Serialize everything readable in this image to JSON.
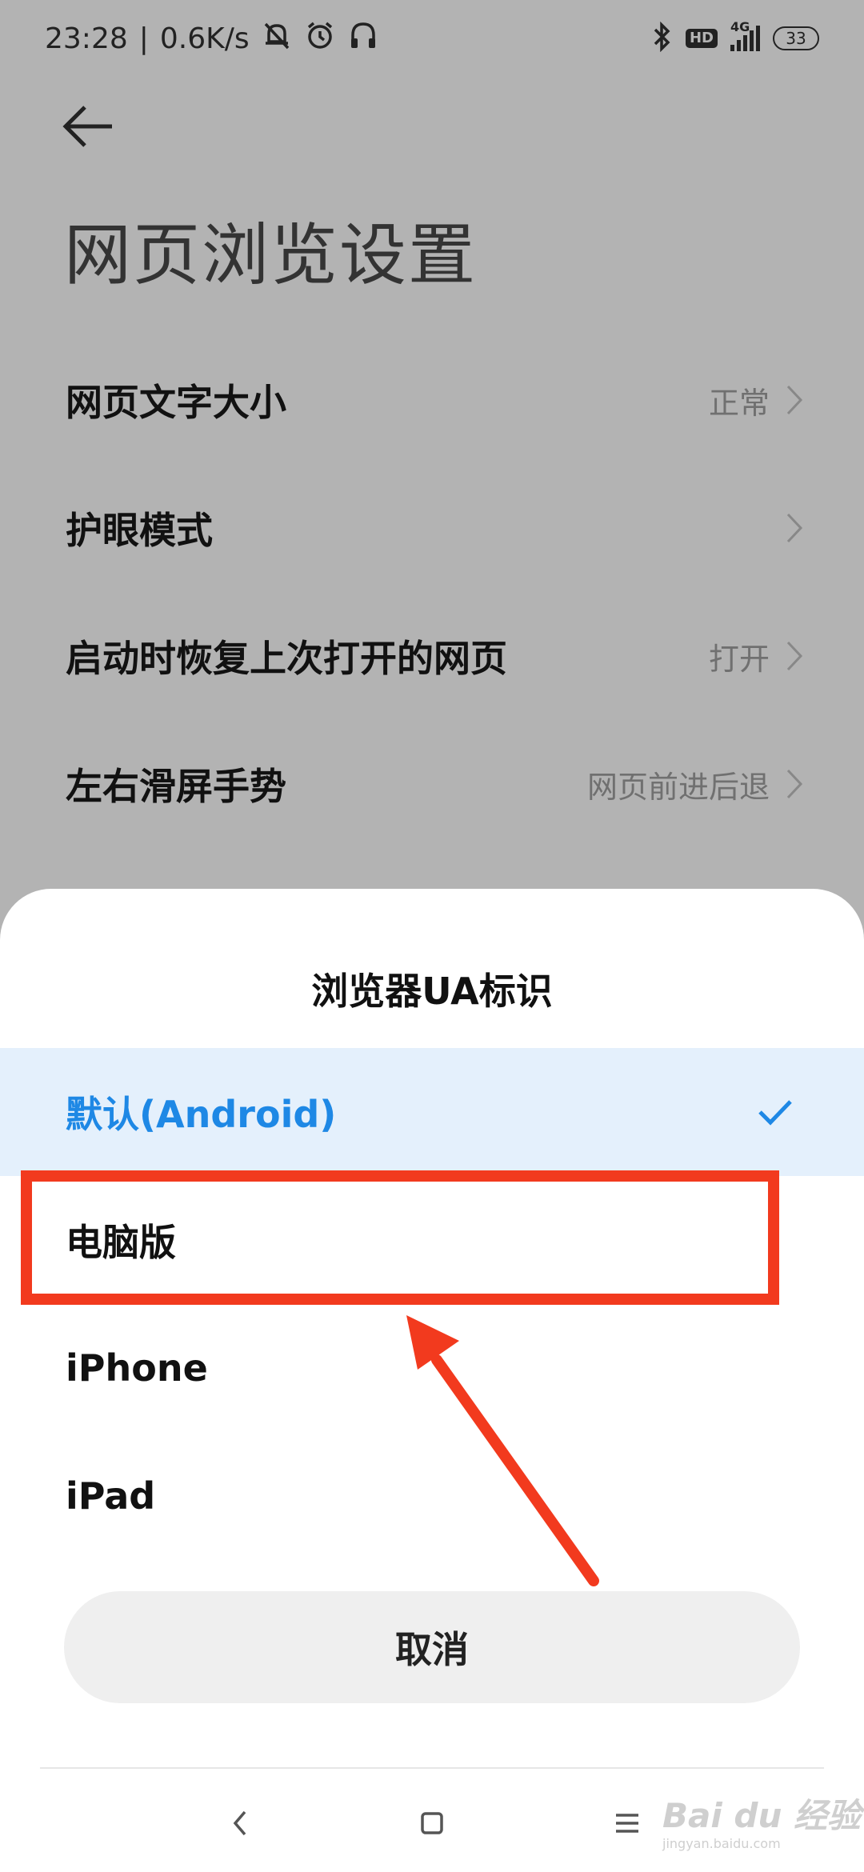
{
  "status_bar": {
    "time": "23:28",
    "separator": "|",
    "net_speed": "0.6K/s",
    "icons": [
      "mute-icon",
      "alarm-icon",
      "headset-icon",
      "bluetooth-icon",
      "hd-icon",
      "signal-icon",
      "battery-icon"
    ],
    "hd_label": "HD",
    "network": "4G",
    "battery": "33"
  },
  "page": {
    "title": "网页浏览设置",
    "settings": [
      {
        "label": "网页文字大小",
        "value": "正常"
      },
      {
        "label": "护眼模式",
        "value": ""
      },
      {
        "label": "启动时恢复上次打开的网页",
        "value": "打开"
      },
      {
        "label": "左右滑屏手势",
        "value": "网页前进后退"
      }
    ]
  },
  "dialog": {
    "title": "浏览器UA标识",
    "options": [
      {
        "label": "默认(Android)",
        "selected": true
      },
      {
        "label": "电脑版",
        "selected": false
      },
      {
        "label": "iPhone",
        "selected": false
      },
      {
        "label": "iPad",
        "selected": false
      }
    ],
    "cancel_label": "取消"
  },
  "colors": {
    "scrim": "#b3b3b3",
    "selected_bg": "#e4f0fc",
    "accent": "#1e88e5",
    "annotation": "#f23a1e"
  },
  "watermark": {
    "main": "Bai du 经验",
    "sub": "jingyan.baidu.com"
  }
}
